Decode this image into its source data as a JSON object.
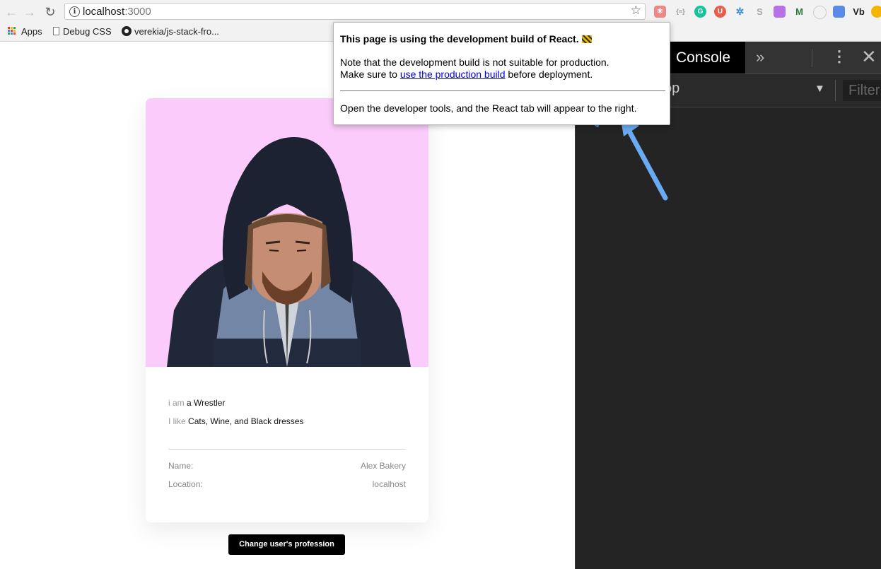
{
  "browser": {
    "url_host": "localhost",
    "url_port": ":3000",
    "bookmarks": [
      "Apps",
      "Debug CSS",
      "verekia/js-stack-fro..."
    ]
  },
  "profile": {
    "iam_prefix": "i am",
    "iam_value": "a Wrestler",
    "like_prefix": "I like",
    "like_value": "Cats, Wine, and Black dresses",
    "name_label": "Name:",
    "name_value": "Alex Bakery",
    "location_label": "Location:",
    "location_value": "localhost",
    "photo_bg": "#facbfb"
  },
  "button_label": "Change user's profession",
  "devtools": {
    "tab_console": "Console",
    "more_tabs": "»",
    "context": "op",
    "filter_placeholder": "Filter"
  },
  "popup": {
    "title": "This page is using the development build of React.",
    "note_line1": "Note that the development build is not suitable for production.",
    "note_prefix": "Make sure to ",
    "note_link": "use the production build",
    "note_suffix": " before deployment.",
    "hint": "Open the developer tools, and the React tab will appear to the right."
  },
  "colors": {
    "arrow": "#6aaaf2",
    "link": "#0000ee"
  }
}
